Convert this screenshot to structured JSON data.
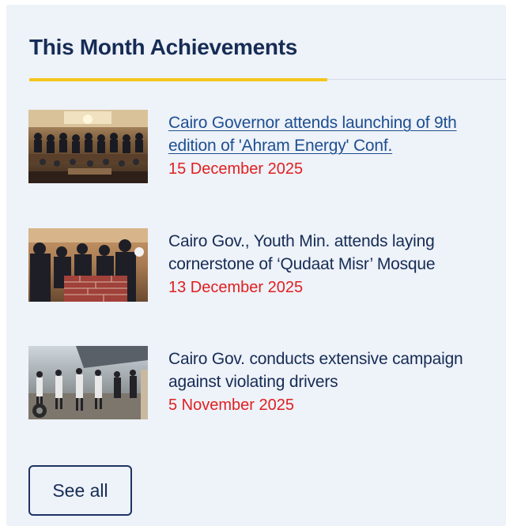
{
  "section": {
    "title": "This Month Achievements"
  },
  "items": [
    {
      "headline": "Cairo Governor attends launching of 9th edition of 'Ahram Energy' Conf.",
      "date": "15 December 2025"
    },
    {
      "headline": "Cairo Gov., Youth Min. attends laying cornerstone of ‘Qudaat Misr’ Mosque",
      "date": "13 December 2025"
    },
    {
      "headline": "Cairo Gov. conducts extensive campaign against violating drivers",
      "date": "5 November 2025"
    }
  ],
  "see_all": {
    "label": "See all"
  },
  "colors": {
    "panel_bg": "#eef2f9",
    "title": "#162c55",
    "accent": "#f3c51b",
    "link": "#1d4f91",
    "date": "#e02020",
    "button_border": "#1d3361"
  }
}
